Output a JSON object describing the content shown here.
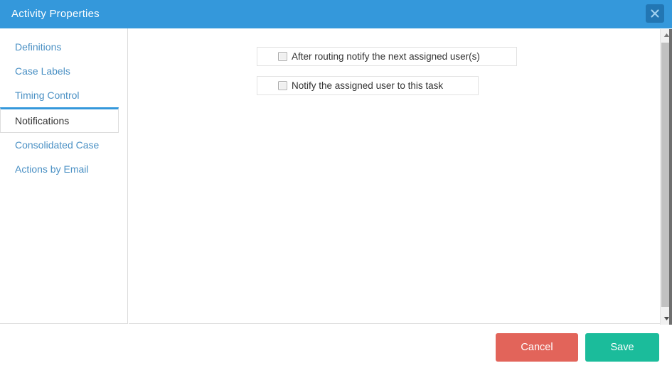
{
  "window": {
    "title": "Activity Properties",
    "close_icon": "close-icon",
    "header_color": "#3498db",
    "close_button_color": "#2276b3"
  },
  "sidebar": {
    "items": [
      {
        "label": "Definitions",
        "active": false
      },
      {
        "label": "Case Labels",
        "active": false
      },
      {
        "label": "Timing Control",
        "active": false
      },
      {
        "label": "Notifications",
        "active": true
      },
      {
        "label": "Consolidated Case",
        "active": false
      },
      {
        "label": "Actions by Email",
        "active": false
      }
    ],
    "link_color": "#4a90c4",
    "active_color": "#333333",
    "active_indicator_color": "#3498db"
  },
  "main": {
    "options": [
      {
        "label": "After routing notify the next assigned user(s)",
        "checked": false
      },
      {
        "label": "Notify the assigned user to this task",
        "checked": false
      }
    ]
  },
  "scrollbar": {
    "up_arrow_icon": "triangle-up-icon",
    "down_arrow_icon": "triangle-down-icon",
    "thumb_color": "#c1c1c1",
    "track_color": "#f1f1f1"
  },
  "footer": {
    "cancel_label": "Cancel",
    "save_label": "Save",
    "cancel_color": "#e2645a",
    "save_color": "#1bbc9b"
  }
}
